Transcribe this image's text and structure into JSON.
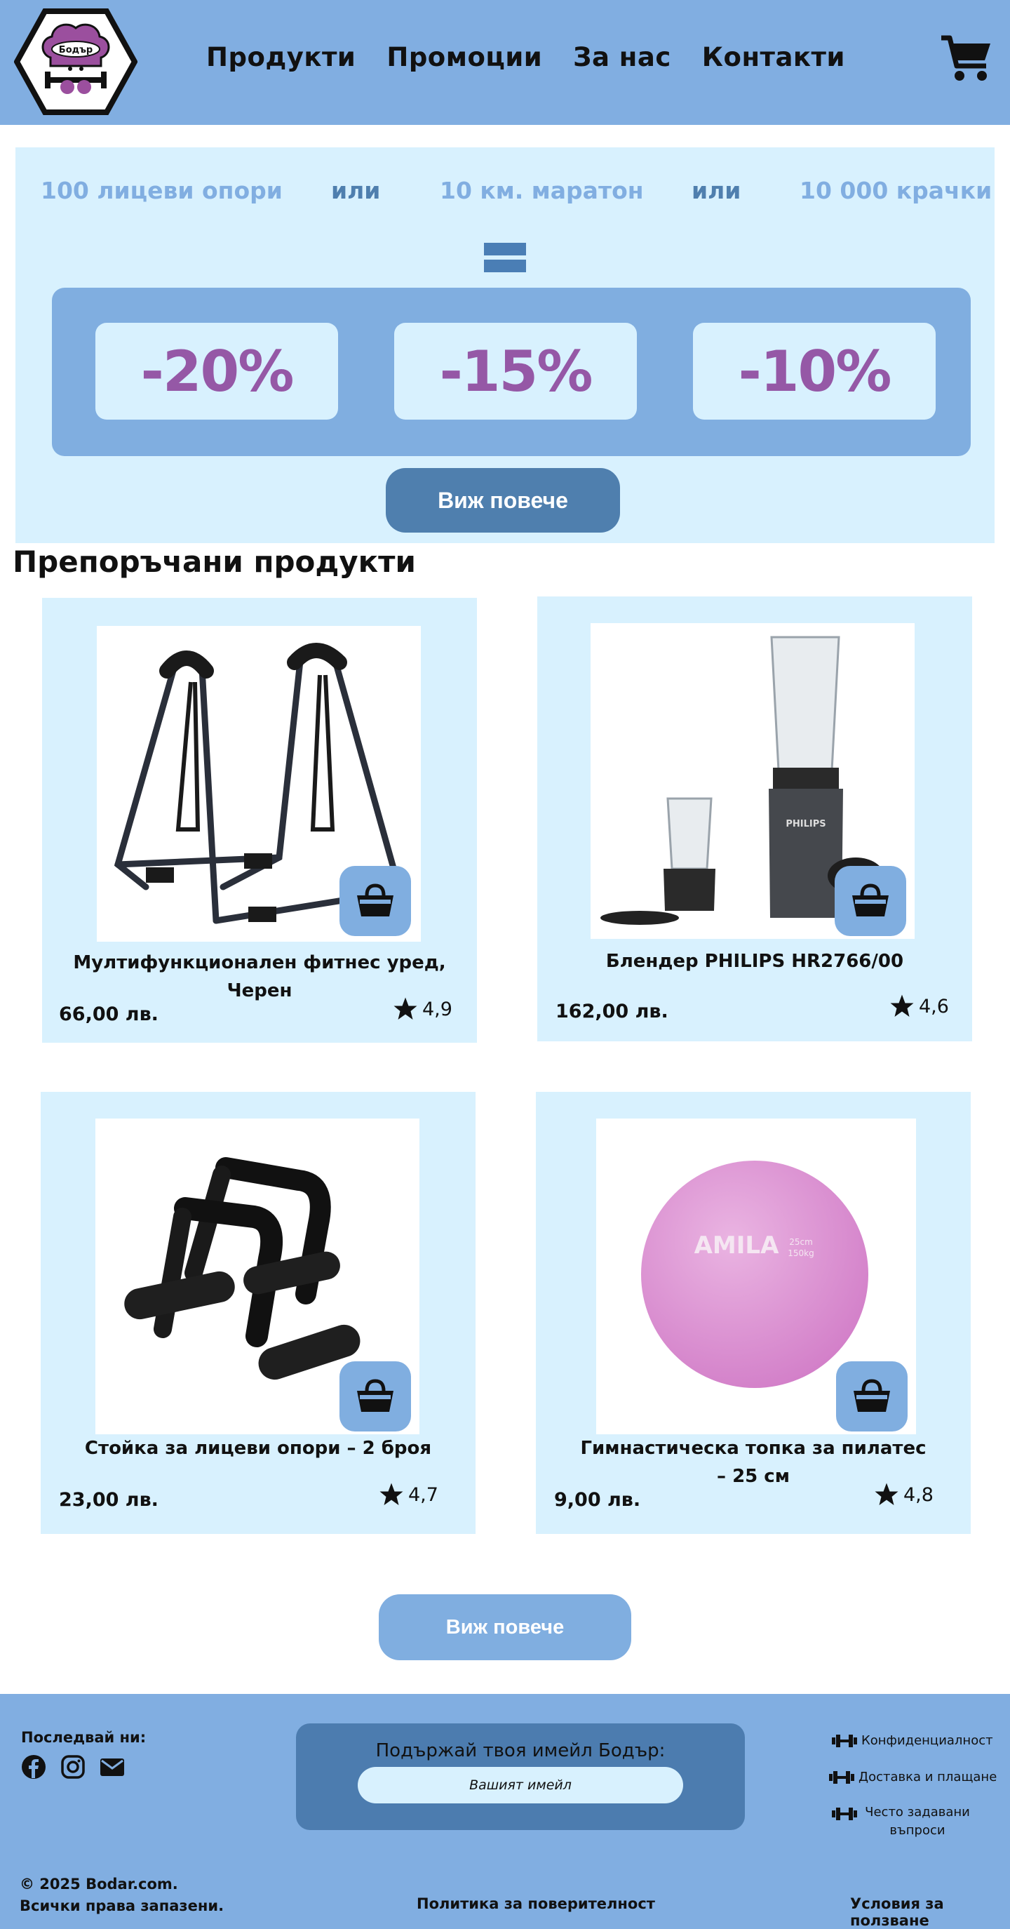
{
  "header": {
    "logo_text": "Бодър",
    "nav": [
      "Продукти",
      "Промоции",
      "За нас",
      "Контакти"
    ]
  },
  "promo": {
    "challenges": [
      "100 лицеви опори",
      "или",
      "10 км. маратон",
      "или",
      "10 000 крачки"
    ],
    "discounts": [
      "-20%",
      "-15%",
      "-10%"
    ],
    "button": "Виж повече"
  },
  "recommended": {
    "title": "Препоръчани продукти",
    "products": [
      {
        "name": "Мултифункционален фитнес уред, Черен",
        "price": "66,00 лв.",
        "rating": "4,9"
      },
      {
        "name": "Блендер PHILIPS HR2766/00",
        "price": "162,00 лв.",
        "rating": "4,6"
      },
      {
        "name": "Стойка за лицеви опори – 2 броя",
        "price": "23,00 лв.",
        "rating": "4,7"
      },
      {
        "name": "Гимнастическа топка за пилатес – 25 см",
        "price": "9,00 лв.",
        "rating": "4,8"
      }
    ],
    "product_image_labels": {
      "blender_brand": "PHILIPS",
      "ball_brand": "AMILA",
      "ball_size": "25cm",
      "ball_weight": "150kg"
    },
    "more_button": "Виж повече"
  },
  "footer": {
    "follow": "Последвай ни:",
    "newsletter_title": "Подържай твоя имейл Бодър:",
    "email_placeholder": "Вашият имейл",
    "links": [
      "Конфиденциалност",
      "Доставка и плащане",
      "Често задавани въпроси"
    ],
    "copyright_line1": "© 2025 Bodar.com.",
    "copyright_line2": "Всички права запазени.",
    "privacy": "Политика за поверителност",
    "terms": "Условия за ползване"
  },
  "colors": {
    "header_bg": "#81aee1",
    "panel_bg": "#d8f1fe",
    "accent_dark": "#4f7fae",
    "discount_text": "#9558a6"
  }
}
